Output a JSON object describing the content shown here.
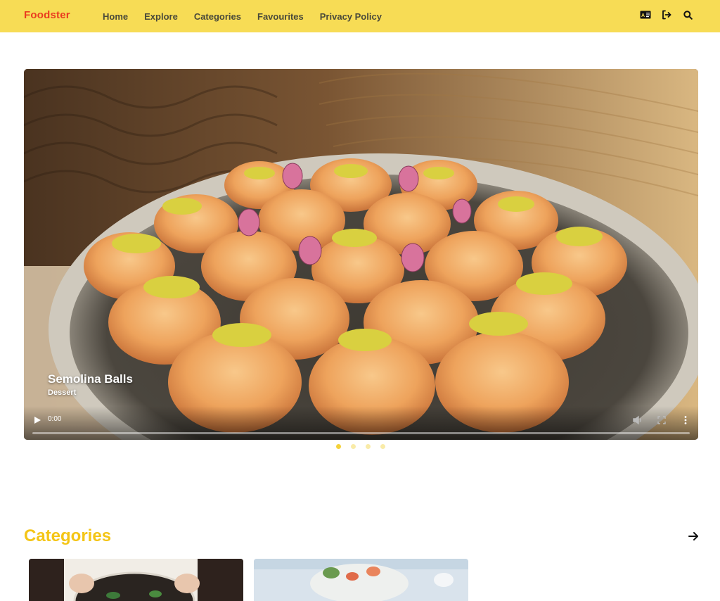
{
  "nav": {
    "brand": "Foodster",
    "links": [
      "Home",
      "Explore",
      "Categories",
      "Favourites",
      "Privacy Policy"
    ],
    "icons": [
      "translate-icon",
      "logout-icon",
      "search-icon"
    ]
  },
  "hero": {
    "title": "Semolina Balls",
    "subtitle": "Dessert",
    "time": "0:00",
    "slides_count": 4,
    "active_slide": 1
  },
  "categories": {
    "title": "Categories"
  },
  "colors": {
    "nav_bg": "#f7dc55",
    "brand": "#ea3b1f",
    "section_title": "#f4c516"
  }
}
